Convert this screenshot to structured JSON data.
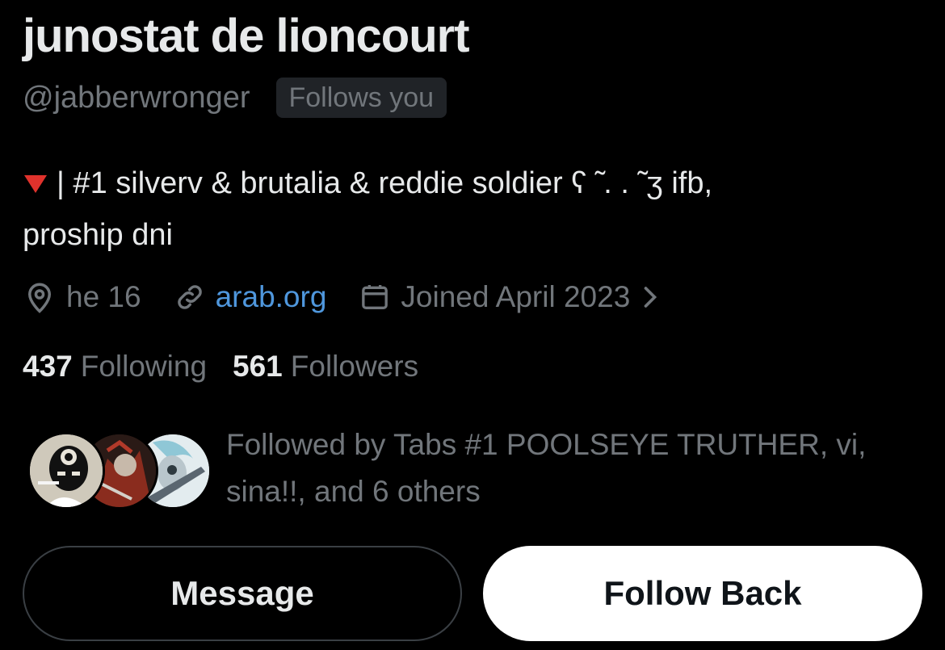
{
  "profile": {
    "name": "junostat de lioncourt",
    "handle": "@jabberwronger",
    "follows_badge": "Follows you",
    "bio_line1": "| #1 silverv & brutalia & reddie soldier ʕ ̃ . . ̃ ʒ ifb,",
    "bio_line2": "proship dni",
    "bio_emoji": "red-triangle-down"
  },
  "meta": {
    "location": "he 16",
    "link": "arab.org",
    "joined": "Joined April 2023",
    "icons": [
      "location-pin-icon",
      "link-icon",
      "calendar-icon",
      "chevron-right-icon"
    ]
  },
  "stats": {
    "following_count": "437",
    "following_label": "Following",
    "followers_count": "561",
    "followers_label": "Followers"
  },
  "followed_by": {
    "line1": "Followed by Tabs #1 POOLSEYE TRUTHER, vi,",
    "line2": "sina!!, and 6 others"
  },
  "actions": {
    "message_label": "Message",
    "follow_back_label": "Follow Back"
  },
  "colors": {
    "background": "#000000",
    "text_primary": "#e7e9ea",
    "text_secondary": "#71767b",
    "link": "#4f97dd",
    "follow_button_bg": "#ffffff"
  }
}
